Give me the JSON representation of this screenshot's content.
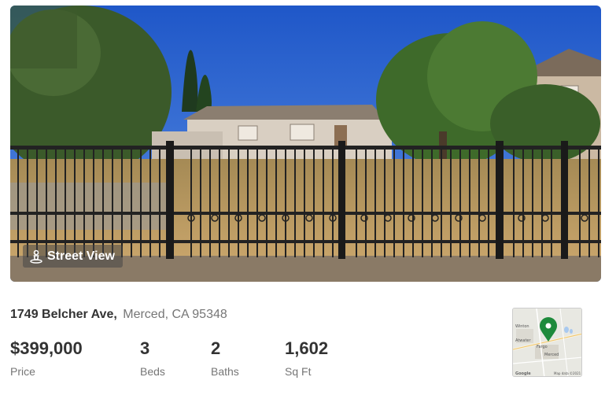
{
  "listing": {
    "street": "1749 Belcher Ave,",
    "city_state_zip": "Merced, CA 95348"
  },
  "photo": {
    "street_view_label": "Street View"
  },
  "stats": [
    {
      "value": "$399,000",
      "label": "Price"
    },
    {
      "value": "3",
      "label": "Beds"
    },
    {
      "value": "2",
      "label": "Baths"
    },
    {
      "value": "1,602",
      "label": "Sq Ft"
    }
  ],
  "map": {
    "place_labels": [
      "Winton",
      "Atwater",
      "Fargo",
      "Merced"
    ],
    "attribution": "Map data ©2021",
    "logo": "Google",
    "pin_color": "#1e8a3c"
  }
}
